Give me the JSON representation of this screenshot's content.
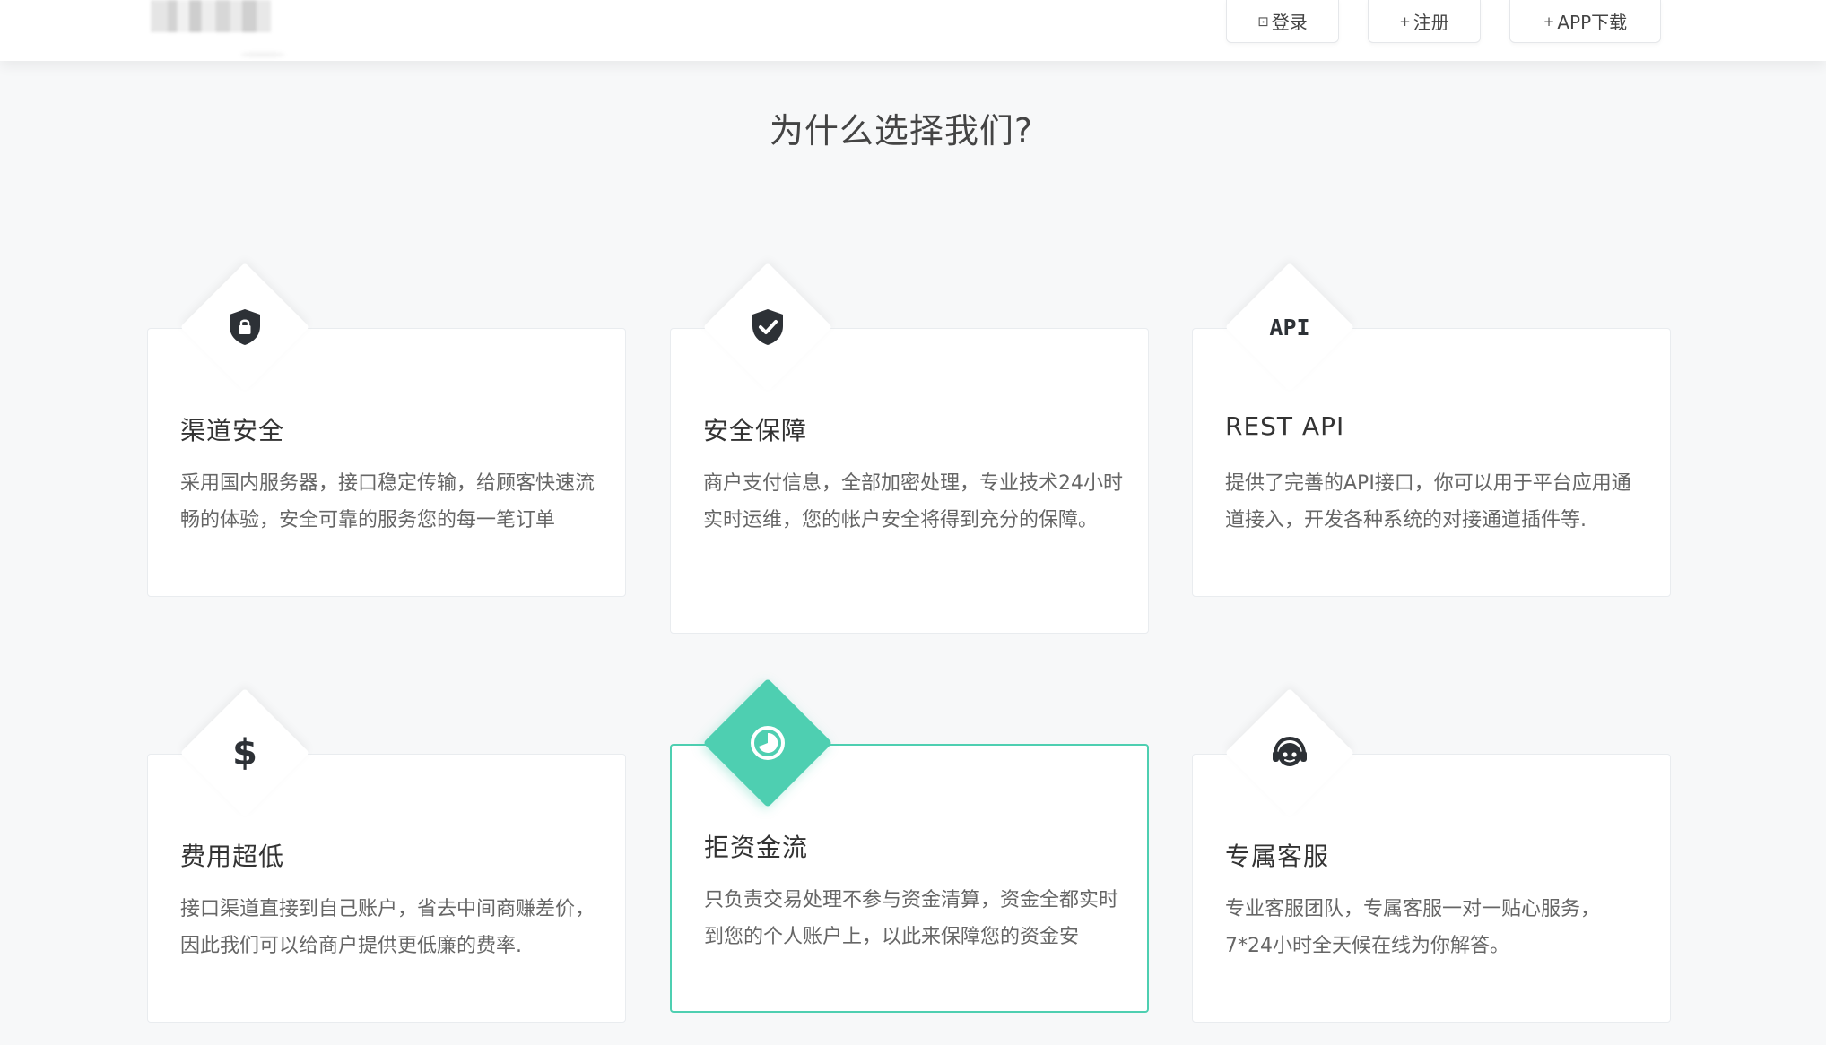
{
  "header": {
    "login_label": "登录",
    "register_label": "注册",
    "app_label": "APP下载"
  },
  "section": {
    "title": "为什么选择我们?"
  },
  "features": [
    {
      "title": "渠道安全",
      "desc": "采用国内服务器，接口稳定传输，给顾客快速流畅的体验，安全可靠的服务您的每一笔订单",
      "icon": "shield-lock-icon"
    },
    {
      "title": "安全保障",
      "desc": "商户支付信息，全部加密处理，专业技术24小时实时运维，您的帐户安全将得到充分的保障。",
      "icon": "shield-check-icon"
    },
    {
      "title": "REST API",
      "desc": "提供了完善的API接口，你可以用于平台应用通道接入，开发各种系统的对接通道插件等.",
      "icon": "api-icon",
      "icon_text": "API"
    },
    {
      "title": "费用超低",
      "desc": "接口渠道直接到自己账户，省去中间商赚差价，因此我们可以给商户提供更低廉的费率.",
      "icon": "dollar-icon",
      "icon_text": "$"
    },
    {
      "title": "拒资金流",
      "desc": "只负责交易处理不参与资金清算，资金全都实时到您的个人账户上，以此来保障您的资金安",
      "icon": "pie-clock-icon"
    },
    {
      "title": "专属客服",
      "desc": "专业客服团队，专属客服一对一贴心服务，7*24小时全天候在线为你解答。",
      "icon": "customer-service-icon"
    }
  ],
  "colors": {
    "accent": "#4ecfb1",
    "background": "#f7f8f9"
  }
}
